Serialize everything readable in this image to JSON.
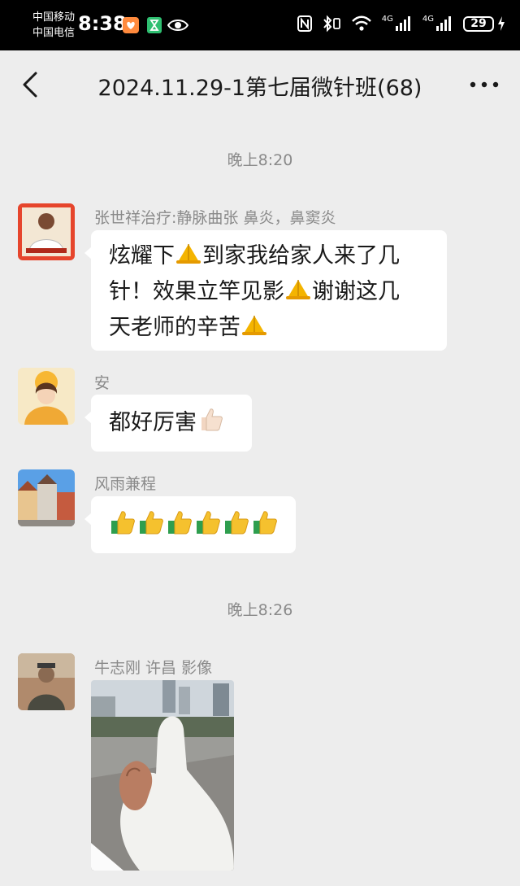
{
  "status_bar": {
    "carrier_1": "中国移动",
    "carrier_2": "中国电信",
    "time": "8:38",
    "net_1": "4G",
    "net_2": "4G",
    "battery": "29"
  },
  "header": {
    "title": "2024.11.29-1第七届微针班(68)"
  },
  "timestamps": [
    "晚上8:20",
    "晚上8:26"
  ],
  "messages": [
    {
      "sender": "张世祥治疗:静脉曲张 鼻炎，鼻窦炎",
      "text_lines": [
        "炫耀下",
        "到家我给家人来了几",
        "针！效果立竿见影",
        "谢谢这几",
        "天老师的辛苦"
      ],
      "emoji": "folded-hands"
    },
    {
      "sender": "安",
      "text": "都好厉害",
      "emoji": "thumbs-up"
    },
    {
      "sender": "风雨兼程",
      "emoji": "thumbs-up",
      "emoji_count": 6
    },
    {
      "sender": "牛志刚  许昌  影像",
      "type": "image"
    }
  ],
  "colors": {
    "background": "#ededed",
    "bubble": "#ffffff",
    "meta_text": "#8a8a8a"
  }
}
